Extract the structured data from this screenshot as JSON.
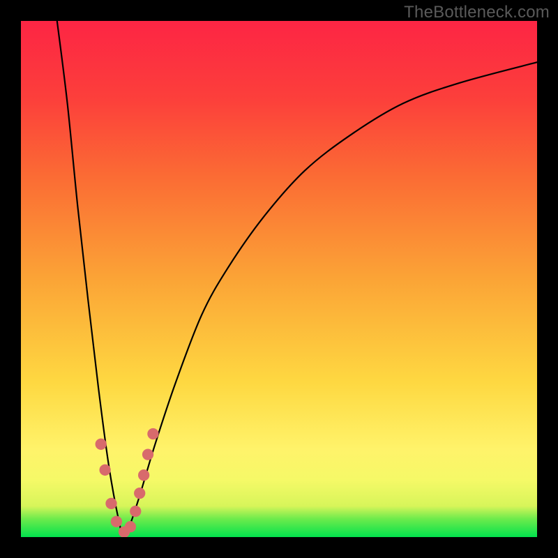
{
  "watermark": "TheBottleneck.com",
  "chart_data": {
    "type": "line",
    "title": "",
    "xlabel": "",
    "ylabel": "",
    "xlim": [
      0,
      100
    ],
    "ylim": [
      0,
      100
    ],
    "gradient_bands": [
      {
        "name": "optimal",
        "color": "#02e24d",
        "from": 0,
        "to": 4
      },
      {
        "name": "good",
        "color": "#d7f55a",
        "from": 4,
        "to": 12
      },
      {
        "name": "light",
        "color": "#fff36a",
        "from": 12,
        "to": 22
      },
      {
        "name": "mid",
        "color": "#fdd63c",
        "from": 22,
        "to": 50
      },
      {
        "name": "warn",
        "color": "#fb8a2f",
        "from": 50,
        "to": 78
      },
      {
        "name": "bad",
        "color": "#fc2b3f",
        "from": 78,
        "to": 100
      }
    ],
    "curve": {
      "description": "Bottleneck percentage curve; x in [0,100], y in [0,100]; minimum at x≈20.",
      "min_x": 20,
      "points": [
        {
          "x": 7,
          "y": 100
        },
        {
          "x": 9,
          "y": 84
        },
        {
          "x": 11,
          "y": 64
        },
        {
          "x": 13,
          "y": 46
        },
        {
          "x": 15,
          "y": 29
        },
        {
          "x": 17,
          "y": 14
        },
        {
          "x": 19,
          "y": 3
        },
        {
          "x": 20,
          "y": 0
        },
        {
          "x": 21,
          "y": 2
        },
        {
          "x": 23,
          "y": 8
        },
        {
          "x": 26,
          "y": 18
        },
        {
          "x": 30,
          "y": 30
        },
        {
          "x": 35,
          "y": 43
        },
        {
          "x": 40,
          "y": 52
        },
        {
          "x": 47,
          "y": 62
        },
        {
          "x": 55,
          "y": 71
        },
        {
          "x": 64,
          "y": 78
        },
        {
          "x": 74,
          "y": 84
        },
        {
          "x": 85,
          "y": 88
        },
        {
          "x": 100,
          "y": 92
        }
      ]
    },
    "markers": {
      "color": "#d86a6c",
      "radius_pct": 1.1,
      "points": [
        {
          "x": 15.5,
          "y": 18
        },
        {
          "x": 16.3,
          "y": 13
        },
        {
          "x": 17.5,
          "y": 6.5
        },
        {
          "x": 18.5,
          "y": 3
        },
        {
          "x": 20.0,
          "y": 1
        },
        {
          "x": 21.2,
          "y": 2
        },
        {
          "x": 22.2,
          "y": 5
        },
        {
          "x": 23.0,
          "y": 8.5
        },
        {
          "x": 23.8,
          "y": 12
        },
        {
          "x": 24.6,
          "y": 16
        },
        {
          "x": 25.6,
          "y": 20
        }
      ]
    }
  }
}
